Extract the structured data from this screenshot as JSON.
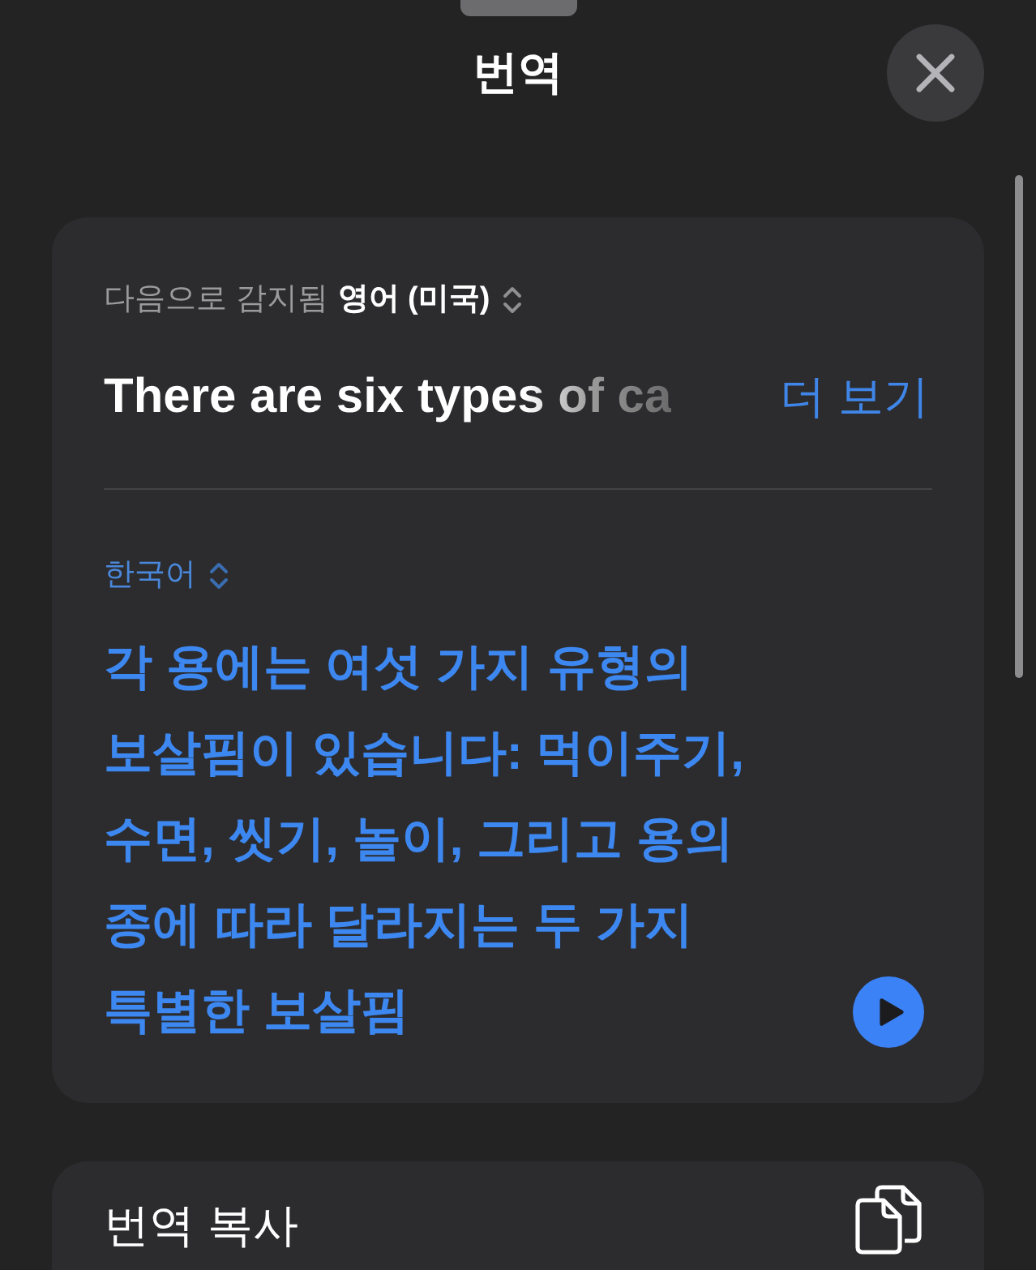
{
  "sheet": {
    "title": "번역"
  },
  "source": {
    "detected_label": "다음으로 감지됨",
    "language": "영어 (미국)",
    "text": "There are six types of ca",
    "more_link": "더 보기"
  },
  "target": {
    "language": "한국어",
    "text": "각 용에는 여섯 가지 유형의 보살핌이 있습니다: 먹이주기, 수면, 씻기, 놀이, 그리고 용의 종에 따라 달라지는 두 가지 특별한 보살핌"
  },
  "actions": [
    {
      "label": "번역 복사"
    }
  ]
}
